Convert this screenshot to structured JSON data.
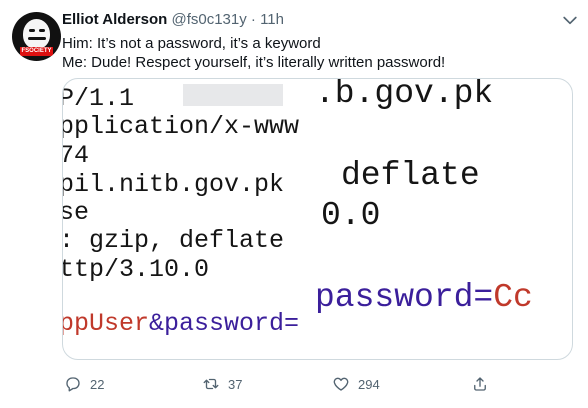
{
  "tweet": {
    "author_name": "Elliot Alderson",
    "handle": "@fs0c131y",
    "separator": "·",
    "time": "11h",
    "lines": [
      "Him: It’s not a password, it’s a keyword",
      "Me: Dude! Respect yourself, it’s literally written password!"
    ],
    "avatar_badge": "FSOCIETY"
  },
  "image": {
    "left_lines": [
      "P/1.1",
      "pplication/x-www",
      " 74",
      "pil.nitb.gov.pk",
      "se",
      ": gzip, deflate",
      "ttp/3.10.0"
    ],
    "left_bottom": {
      "part1": "ppUser",
      "part2": "&password="
    },
    "right_lines": [
      ".b.gov.pk",
      "deflate",
      "0.0"
    ],
    "right_bottom": {
      "part1": "password=",
      "part2": "Cc"
    }
  },
  "actions": {
    "replies": "22",
    "retweets": "37",
    "likes": "294"
  }
}
